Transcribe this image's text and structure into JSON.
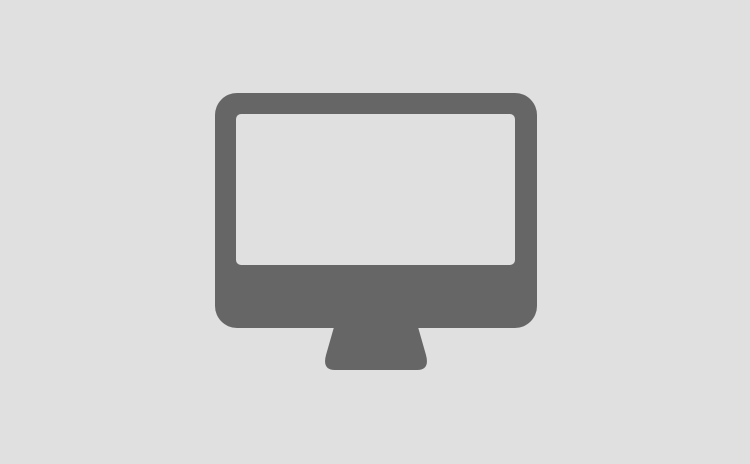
{
  "background_color": "#e0e0e0",
  "icon": {
    "name": "desktop-monitor-icon",
    "color": "#666666",
    "screen_color": "#e0e0e0"
  }
}
